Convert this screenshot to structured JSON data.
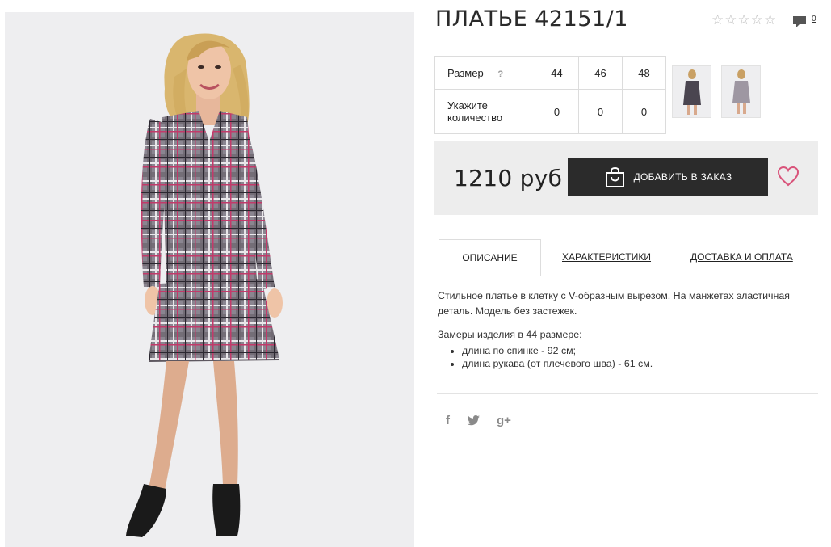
{
  "product": {
    "title": "ПЛАТЬЕ 42151/1",
    "rating_stars": 5,
    "rating_value": 0,
    "comments_count": "0"
  },
  "size_table": {
    "size_label": "Размер",
    "help_label": "?",
    "sizes": [
      "44",
      "46",
      "48"
    ],
    "quantity_label": "Укажите количество",
    "quantities": [
      "0",
      "0",
      "0"
    ]
  },
  "thumbnails": [
    "photo-front-thumbnail",
    "photo-side-thumbnail"
  ],
  "price_box": {
    "price": "1210 руб",
    "add_to_order_label": "ДОБАВИТЬ В ЗАКАЗ"
  },
  "tabs": [
    {
      "label": "ОПИСАНИЕ",
      "active": true
    },
    {
      "label": "ХАРАКТЕРИСТИКИ",
      "active": false
    },
    {
      "label": "ДОСТАВКА И ОПЛАТА",
      "active": false
    }
  ],
  "description": {
    "text": "Стильное платье в клетку с V-образным вырезом. На манжетах эластичная деталь. Модель без застежек.",
    "measurements_title": "Замеры изделия в 44 размере:",
    "measurements": [
      "длина по спинке - 92 см;",
      "длина рукава (от плечевого шва) - 61 см."
    ]
  },
  "social": {
    "facebook": "f",
    "twitter_icon": "twitter-icon",
    "googleplus": "g+"
  },
  "colors": {
    "button_bg": "#2b2b2b",
    "price_box_bg": "#ededed",
    "heart": "#d9537a",
    "photo_bg": "#eeeef0"
  }
}
